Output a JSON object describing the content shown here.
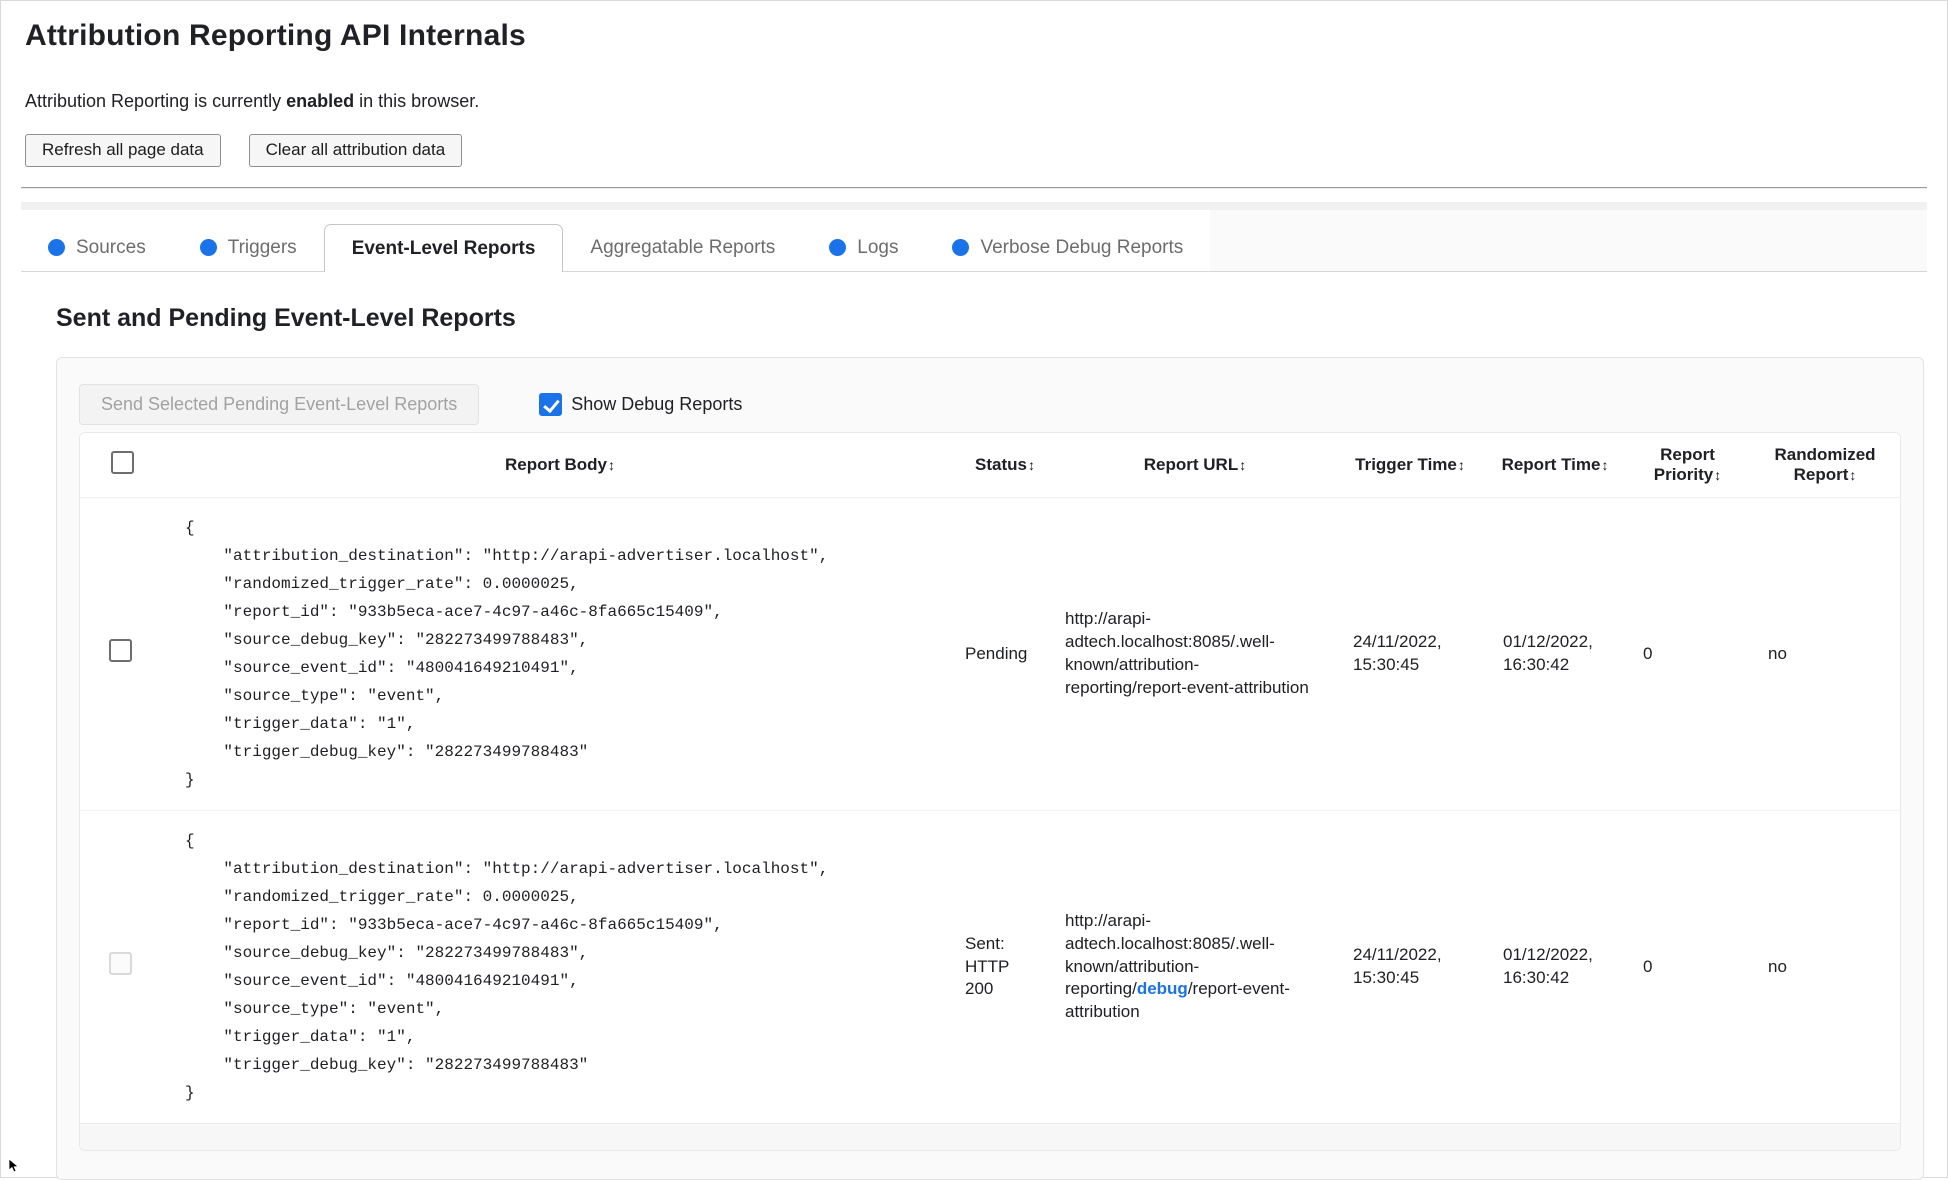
{
  "page": {
    "title": "Attribution Reporting API Internals"
  },
  "status_line": {
    "prefix": "Attribution Reporting is currently ",
    "state": "enabled",
    "suffix": " in this browser."
  },
  "toolbar": {
    "refresh_label": "Refresh all page data",
    "clear_label": "Clear all attribution data"
  },
  "tabs": {
    "items": [
      {
        "label": "Sources",
        "has_indicator": true,
        "active": false
      },
      {
        "label": "Triggers",
        "has_indicator": true,
        "active": false
      },
      {
        "label": "Event-Level Reports",
        "has_indicator": false,
        "active": true
      },
      {
        "label": "Aggregatable Reports",
        "has_indicator": false,
        "active": false
      },
      {
        "label": "Logs",
        "has_indicator": true,
        "active": false
      },
      {
        "label": "Verbose Debug Reports",
        "has_indicator": true,
        "active": false
      }
    ],
    "indicator_color": "#1a73e8"
  },
  "section": {
    "heading": "Sent and Pending Event-Level Reports"
  },
  "panel": {
    "send_button_label": "Send Selected Pending Event-Level Reports",
    "send_button_enabled": false,
    "show_debug_label": "Show Debug Reports",
    "show_debug_checked": true
  },
  "table": {
    "sort_icon": "↕",
    "headers": {
      "report_body": "Report Body",
      "status": "Status",
      "report_url": "Report URL",
      "trigger_time": "Trigger Time",
      "report_time": "Report Time",
      "report_priority": "Report Priority",
      "randomized_report": "Randomized Report"
    },
    "rows": [
      {
        "selectable": true,
        "selected": false,
        "report_body_lines": [
          "{",
          "    \"attribution_destination\": \"http://arapi-advertiser.localhost\",",
          "    \"randomized_trigger_rate\": 0.0000025,",
          "    \"report_id\": \"933b5eca-ace7-4c97-a46c-8fa665c15409\",",
          "    \"source_debug_key\": \"282273499788483\",",
          "    \"source_event_id\": \"480041649210491\",",
          "    \"source_type\": \"event\",",
          "    \"trigger_data\": \"1\",",
          "    \"trigger_debug_key\": \"282273499788483\"",
          "}"
        ],
        "status": "Pending",
        "report_url": {
          "prefix": "http://arapi-adtech.localhost:8085/.well-known/attribution-reporting/",
          "debug_segment": "",
          "suffix": "report-event-attribution"
        },
        "trigger_time": "24/11/2022, 15:30:45",
        "report_time": "01/12/2022, 16:30:42",
        "report_priority": "0",
        "randomized_report": "no"
      },
      {
        "selectable": false,
        "selected": false,
        "report_body_lines": [
          "{",
          "    \"attribution_destination\": \"http://arapi-advertiser.localhost\",",
          "    \"randomized_trigger_rate\": 0.0000025,",
          "    \"report_id\": \"933b5eca-ace7-4c97-a46c-8fa665c15409\",",
          "    \"source_debug_key\": \"282273499788483\",",
          "    \"source_event_id\": \"480041649210491\",",
          "    \"source_type\": \"event\",",
          "    \"trigger_data\": \"1\",",
          "    \"trigger_debug_key\": \"282273499788483\"",
          "}"
        ],
        "status": "Sent: HTTP 200",
        "report_url": {
          "prefix": "http://arapi-adtech.localhost:8085/.well-known/attribution-reporting/",
          "debug_segment": "debug",
          "suffix": "/report-event-attribution"
        },
        "trigger_time": "24/11/2022, 15:30:45",
        "report_time": "01/12/2022, 16:30:42",
        "report_priority": "0",
        "randomized_report": "no"
      }
    ]
  }
}
